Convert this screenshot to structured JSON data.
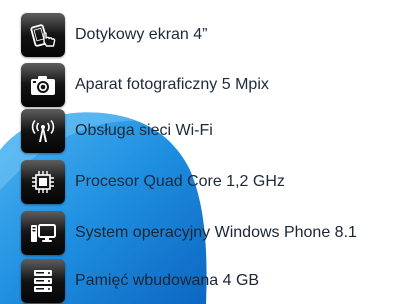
{
  "features": [
    {
      "icon": "touchscreen-phone-icon",
      "text": "Dotykowy ekran 4”"
    },
    {
      "icon": "camera-icon",
      "text": "Aparat fotograficzny 5 Mpix"
    },
    {
      "icon": "wifi-antenna-icon",
      "text": "Obsługa sieci Wi-Fi"
    },
    {
      "icon": "processor-chip-icon",
      "text": "Procesor Quad Core 1,2 GHz"
    },
    {
      "icon": "computer-monitor-icon",
      "text": "System operacyjny Windows Phone 8.1"
    },
    {
      "icon": "server-storage-icon",
      "text": "Pamięć wbudowana 4 GB"
    }
  ],
  "colors": {
    "accent_blue": "#1e8fe0",
    "icon_background": "#111111",
    "text": "#1d2a3a"
  }
}
